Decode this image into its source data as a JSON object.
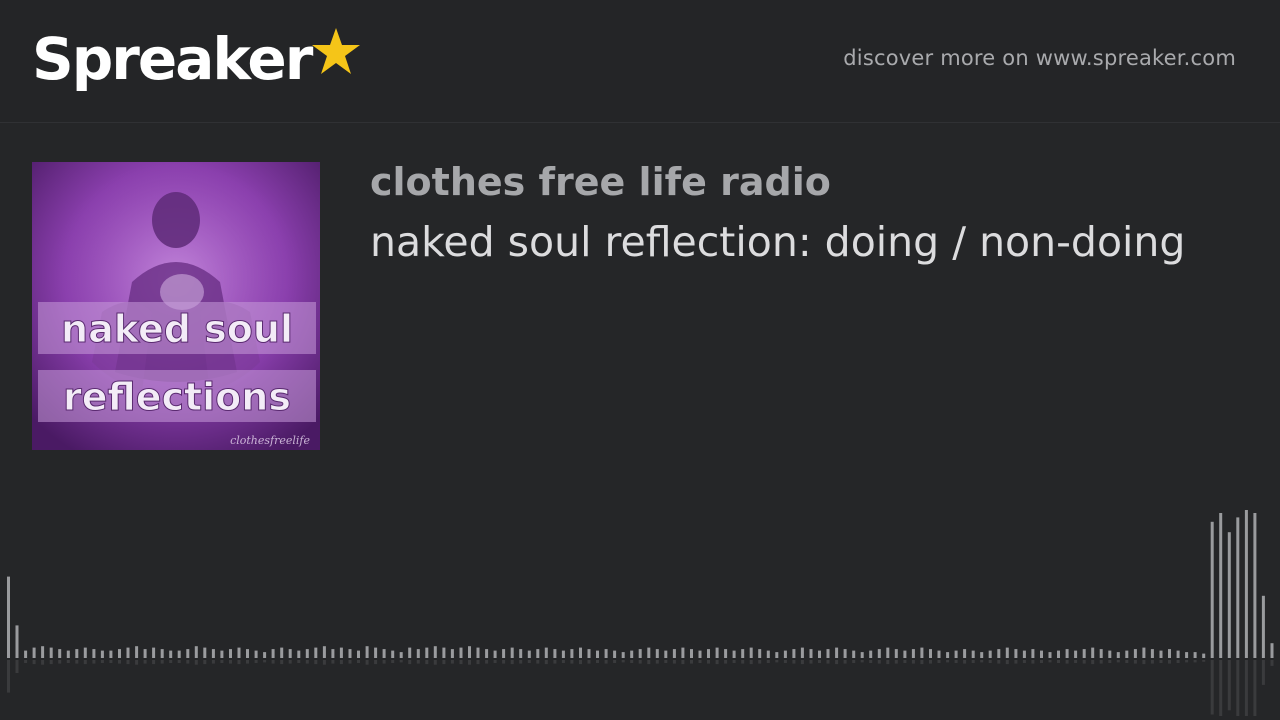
{
  "header": {
    "brand": "Spreaker",
    "discover_text": "discover more on www.spreaker.com"
  },
  "cover": {
    "line1": "naked soul",
    "line2": "reflections",
    "signature": "clothesfreelife"
  },
  "show": {
    "title": "clothes free life radio"
  },
  "episode": {
    "title": "naked soul reflection: doing / non-doing"
  },
  "colors": {
    "background": "#252628",
    "brand_star": "#f5c518",
    "waveform_bar": "#9a9b9e"
  },
  "waveform": {
    "levels": [
      0.55,
      0.22,
      0.05,
      0.07,
      0.08,
      0.07,
      0.06,
      0.05,
      0.06,
      0.07,
      0.06,
      0.05,
      0.05,
      0.06,
      0.07,
      0.08,
      0.06,
      0.07,
      0.06,
      0.05,
      0.05,
      0.06,
      0.08,
      0.07,
      0.06,
      0.05,
      0.06,
      0.07,
      0.06,
      0.05,
      0.04,
      0.06,
      0.07,
      0.06,
      0.05,
      0.06,
      0.07,
      0.08,
      0.06,
      0.07,
      0.06,
      0.05,
      0.08,
      0.07,
      0.06,
      0.05,
      0.04,
      0.07,
      0.06,
      0.07,
      0.08,
      0.07,
      0.06,
      0.07,
      0.08,
      0.07,
      0.06,
      0.05,
      0.06,
      0.07,
      0.06,
      0.05,
      0.06,
      0.07,
      0.06,
      0.05,
      0.06,
      0.07,
      0.06,
      0.05,
      0.06,
      0.05,
      0.04,
      0.05,
      0.06,
      0.07,
      0.06,
      0.05,
      0.06,
      0.07,
      0.06,
      0.05,
      0.06,
      0.07,
      0.06,
      0.05,
      0.06,
      0.07,
      0.06,
      0.05,
      0.04,
      0.05,
      0.06,
      0.07,
      0.06,
      0.05,
      0.06,
      0.07,
      0.06,
      0.05,
      0.04,
      0.05,
      0.06,
      0.07,
      0.06,
      0.05,
      0.06,
      0.07,
      0.06,
      0.05,
      0.04,
      0.05,
      0.06,
      0.05,
      0.04,
      0.05,
      0.06,
      0.07,
      0.06,
      0.05,
      0.06,
      0.05,
      0.04,
      0.05,
      0.06,
      0.05,
      0.06,
      0.07,
      0.06,
      0.05,
      0.04,
      0.05,
      0.06,
      0.07,
      0.06,
      0.05,
      0.06,
      0.05,
      0.04,
      0.04,
      0.03,
      0.92,
      0.98,
      0.85,
      0.95,
      1.0,
      0.98,
      0.42,
      0.1
    ]
  }
}
